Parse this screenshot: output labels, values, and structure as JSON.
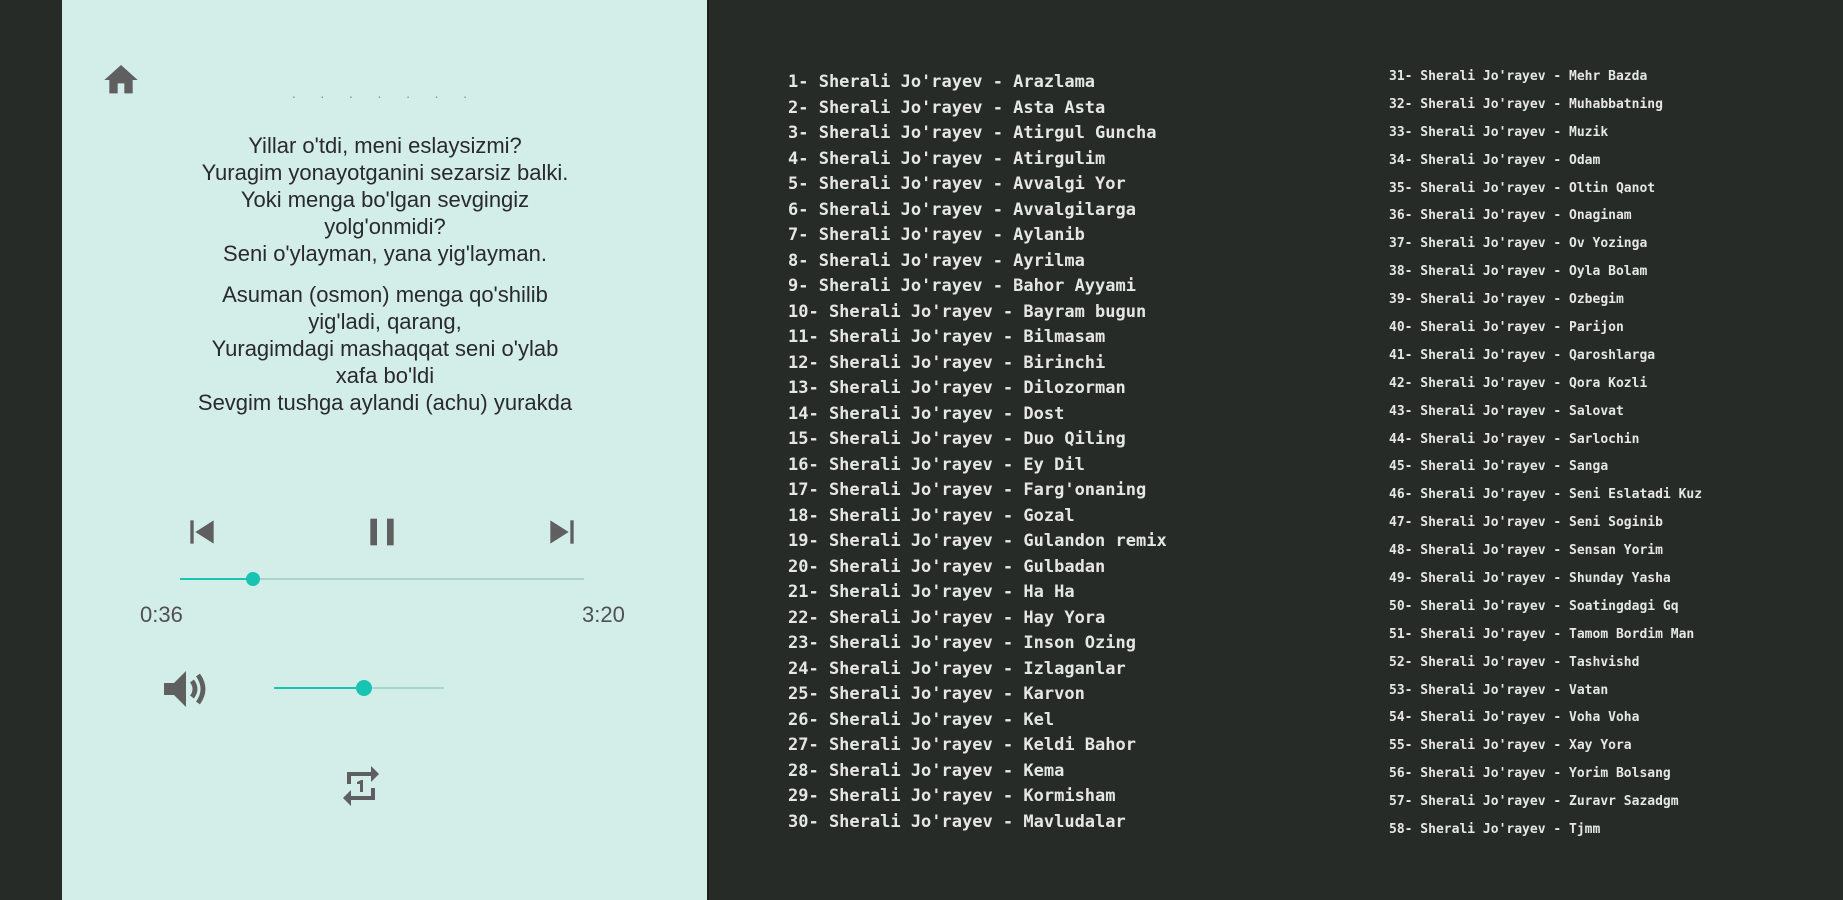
{
  "colors": {
    "player_bg": "#d3ede8",
    "accent": "#19c3b2",
    "dark_bg": "#272b27",
    "track_text": "#e6e6e6",
    "icon": "#5f5f5f"
  },
  "player": {
    "header_dots": "· · · · · · ·",
    "lyrics": [
      [
        "Yillar o'tdi, meni eslaysizmi?",
        "Yuragim yonayotganini sezarsiz balki.",
        "Yoki menga bo'lgan sevgingiz",
        "yolg'onmidi?",
        "Seni o'ylayman, yana yig'layman."
      ],
      [
        "Asuman (osmon) menga qo'shilib",
        "yig'ladi, qarang,",
        "Yuragimdagi mashaqqat seni o'ylab",
        "xafa bo'ldi",
        "Sevgim tushga aylandi (achu) yurakda"
      ]
    ],
    "time_current": "0:36",
    "time_total": "3:20",
    "progress_fraction": 0.18,
    "volume_fraction": 0.53,
    "icons": {
      "home": "home-icon",
      "prev": "skip-previous-icon",
      "pause": "pause-icon",
      "next": "skip-next-icon",
      "volume": "volume-icon",
      "repeat": "repeat-one-icon"
    }
  },
  "playlist": {
    "column_a": [
      "1- Sherali Jo'rayev - Arazlama",
      "2- Sherali Jo'rayev - Asta Asta",
      "3- Sherali Jo'rayev - Atirgul Guncha",
      "4- Sherali Jo'rayev - Atirgulim",
      "5- Sherali Jo'rayev - Avvalgi Yor",
      "6- Sherali Jo'rayev - Avvalgilarga",
      "7- Sherali Jo'rayev - Aylanib",
      "8- Sherali Jo'rayev - Ayrilma",
      "9- Sherali Jo'rayev - Bahor Ayyami",
      "10- Sherali Jo'rayev - Bayram bugun",
      "11- Sherali Jo'rayev - Bilmasam",
      "12- Sherali Jo'rayev - Birinchi",
      "13- Sherali Jo'rayev - Dilozorman",
      "14- Sherali Jo'rayev - Dost",
      "15- Sherali Jo'rayev - Duo Qiling",
      "16- Sherali Jo'rayev - Ey Dil",
      "17- Sherali Jo'rayev - Farg'onaning",
      "18- Sherali Jo'rayev - Gozal",
      "19- Sherali Jo'rayev - Gulandon remix",
      "20- Sherali Jo'rayev - Gulbadan",
      "21- Sherali Jo'rayev - Ha Ha",
      "22- Sherali Jo'rayev - Hay Yora",
      "23- Sherali Jo'rayev - Inson Ozing",
      "24- Sherali Jo'rayev - Izlaganlar",
      "25- Sherali Jo'rayev - Karvon",
      "26- Sherali Jo'rayev - Kel",
      "27- Sherali Jo'rayev - Keldi Bahor",
      "28- Sherali Jo'rayev - Kema",
      "29- Sherali Jo'rayev - Kormisham",
      "30- Sherali Jo'rayev - Mavludalar"
    ],
    "column_b": [
      "31- Sherali Jo'rayev - Mehr Bazda",
      "32- Sherali Jo'rayev - Muhabbatning",
      "33- Sherali Jo'rayev - Muzik",
      "34- Sherali Jo'rayev - Odam",
      "35- Sherali Jo'rayev - Oltin Qanot",
      "36- Sherali Jo'rayev - Onaginam",
      "37- Sherali Jo'rayev - Ov Yozinga",
      "38- Sherali Jo'rayev - Oyla Bolam",
      "39- Sherali Jo'rayev - Ozbegim",
      "40- Sherali Jo'rayev - Parijon",
      "41- Sherali Jo'rayev - Qaroshlarga",
      "42- Sherali Jo'rayev - Qora Kozli",
      "43- Sherali Jo'rayev - Salovat",
      "44- Sherali Jo'rayev - Sarlochin",
      "45- Sherali Jo'rayev - Sanga",
      "46- Sherali Jo'rayev - Seni Eslatadi Kuz",
      "47- Sherali Jo'rayev - Seni Soginib",
      "48- Sherali Jo'rayev - Sensan Yorim",
      "49- Sherali Jo'rayev - Shunday Yasha",
      "50- Sherali Jo'rayev - Soatingdagi Gq",
      "51- Sherali Jo'rayev - Tamom Bordim Man",
      "52- Sherali Jo'rayev - Tashvishd",
      "53- Sherali Jo'rayev - Vatan",
      "54- Sherali Jo'rayev - Voha Voha",
      "55- Sherali Jo'rayev - Xay Yora",
      "56- Sherali Jo'rayev - Yorim Bolsang",
      "57- Sherali Jo'rayev - Zuravr Sazadgm",
      "58- Sherali Jo'rayev - Tjmm"
    ]
  }
}
